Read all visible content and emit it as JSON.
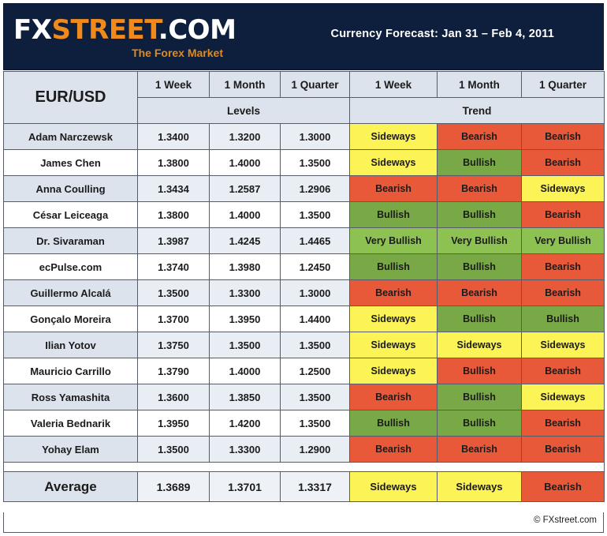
{
  "banner": {
    "logo": {
      "fx": "FX",
      "street": "STREET",
      "com": ".COM",
      "tagline": "The Forex Market"
    },
    "title": "Currency Forecast: Jan 31 – Feb 4, 2011",
    "bg_color": "#0e1f3d",
    "accent_color": "#f08a1c"
  },
  "table": {
    "pair": "EUR/USD",
    "period_headers": [
      "1 Week",
      "1 Month",
      "1 Quarter",
      "1 Week",
      "1 Month",
      "1 Quarter"
    ],
    "group_headers": [
      "Levels",
      "Trend"
    ],
    "rows": [
      {
        "name": "Adam Narczewsk",
        "levels": [
          "1.3400",
          "1.3200",
          "1.3000"
        ],
        "level_colors": [
          "v-red",
          "v-red",
          "v-red"
        ],
        "trends": [
          "Sideways",
          "Bearish",
          "Bearish"
        ],
        "trend_classes": [
          "t-sideways",
          "t-bearish",
          "t-bearish"
        ]
      },
      {
        "name": "James Chen",
        "levels": [
          "1.3800",
          "1.4000",
          "1.3500"
        ],
        "level_colors": [
          "v-orange",
          "v-green",
          "v-red"
        ],
        "trends": [
          "Sideways",
          "Bullish",
          "Bearish"
        ],
        "trend_classes": [
          "t-sideways",
          "t-bullish",
          "t-bearish"
        ]
      },
      {
        "name": "Anna Coulling",
        "levels": [
          "1.3434",
          "1.2587",
          "1.2906"
        ],
        "level_colors": [
          "v-red",
          "v-red",
          "v-red"
        ],
        "trends": [
          "Bearish",
          "Bearish",
          "Sideways"
        ],
        "trend_classes": [
          "t-bearish",
          "t-bearish",
          "t-sideways"
        ]
      },
      {
        "name": "César Leiceaga",
        "levels": [
          "1.3800",
          "1.4000",
          "1.3500"
        ],
        "level_colors": [
          "v-orange",
          "v-green",
          "v-red"
        ],
        "trends": [
          "Bullish",
          "Bullish",
          "Bearish"
        ],
        "trend_classes": [
          "t-bullish",
          "t-bullish",
          "t-bearish"
        ]
      },
      {
        "name": "Dr. Sivaraman",
        "levels": [
          "1.3987",
          "1.4245",
          "1.4465"
        ],
        "level_colors": [
          "v-green",
          "v-green",
          "v-green"
        ],
        "trends": [
          "Very Bullish",
          "Very Bullish",
          "Very Bullish"
        ],
        "trend_classes": [
          "t-verybullish",
          "t-verybullish",
          "t-verybullish"
        ]
      },
      {
        "name": "ecPulse.com",
        "levels": [
          "1.3740",
          "1.3980",
          "1.2450"
        ],
        "level_colors": [
          "v-orange",
          "v-green",
          "v-red"
        ],
        "trends": [
          "Bullish",
          "Bullish",
          "Bearish"
        ],
        "trend_classes": [
          "t-bullish",
          "t-bullish",
          "t-bearish"
        ]
      },
      {
        "name": "Guillermo Alcalá",
        "levels": [
          "1.3500",
          "1.3300",
          "1.3000"
        ],
        "level_colors": [
          "v-red",
          "v-red",
          "v-red"
        ],
        "trends": [
          "Bearish",
          "Bearish",
          "Bearish"
        ],
        "trend_classes": [
          "t-bearish",
          "t-bearish",
          "t-bearish"
        ]
      },
      {
        "name": "Gonçalo Moreira",
        "levels": [
          "1.3700",
          "1.3950",
          "1.4400"
        ],
        "level_colors": [
          "v-orange",
          "v-green",
          "v-green"
        ],
        "trends": [
          "Sideways",
          "Bullish",
          "Bullish"
        ],
        "trend_classes": [
          "t-sideways",
          "t-bullish",
          "t-bullish"
        ]
      },
      {
        "name": "Ilian Yotov",
        "levels": [
          "1.3750",
          "1.3500",
          "1.3500"
        ],
        "level_colors": [
          "v-orange",
          "v-red",
          "v-red"
        ],
        "trends": [
          "Sideways",
          "Sideways",
          "Sideways"
        ],
        "trend_classes": [
          "t-sideways",
          "t-sideways",
          "t-sideways"
        ]
      },
      {
        "name": "Mauricio Carrillo",
        "levels": [
          "1.3790",
          "1.4000",
          "1.2500"
        ],
        "level_colors": [
          "v-orange",
          "v-red",
          "v-red"
        ],
        "trends": [
          "Sideways",
          "Bullish",
          "Bearish"
        ],
        "trend_classes": [
          "t-sideways",
          "t-bearish",
          "t-bearish"
        ]
      },
      {
        "name": "Ross Yamashita",
        "levels": [
          "1.3600",
          "1.3850",
          "1.3500"
        ],
        "level_colors": [
          "v-red",
          "v-green",
          "v-red"
        ],
        "trends": [
          "Bearish",
          "Bullish",
          "Sideways"
        ],
        "trend_classes": [
          "t-bearish",
          "t-bullish",
          "t-sideways"
        ]
      },
      {
        "name": "Valeria Bednarik",
        "levels": [
          "1.3950",
          "1.4200",
          "1.3500"
        ],
        "level_colors": [
          "v-green",
          "v-green",
          "v-red"
        ],
        "trends": [
          "Bullish",
          "Bullish",
          "Bearish"
        ],
        "trend_classes": [
          "t-bullish",
          "t-bullish",
          "t-bearish"
        ]
      },
      {
        "name": "Yohay Elam",
        "levels": [
          "1.3500",
          "1.3300",
          "1.2900"
        ],
        "level_colors": [
          "v-red",
          "v-red",
          "v-red"
        ],
        "trends": [
          "Bearish",
          "Bearish",
          "Bearish"
        ],
        "trend_classes": [
          "t-bearish",
          "t-bearish",
          "t-bearish"
        ]
      }
    ],
    "average": {
      "label": "Average",
      "levels": [
        "1.3689",
        "1.3701",
        "1.3317"
      ],
      "level_colors": [
        "v-orange",
        "v-orange",
        "v-red"
      ],
      "trends": [
        "Sideways",
        "Sideways",
        "Bearish"
      ],
      "trend_classes": [
        "t-sideways",
        "t-sideways",
        "t-bearish"
      ]
    }
  },
  "footer": {
    "copyright": "© FXstreet.com"
  },
  "colors": {
    "bearish": "#e8593a",
    "bullish": "#79a846",
    "very_bullish": "#8dc152",
    "sideways": "#fcf357",
    "header_bg": "#dde3ec"
  }
}
